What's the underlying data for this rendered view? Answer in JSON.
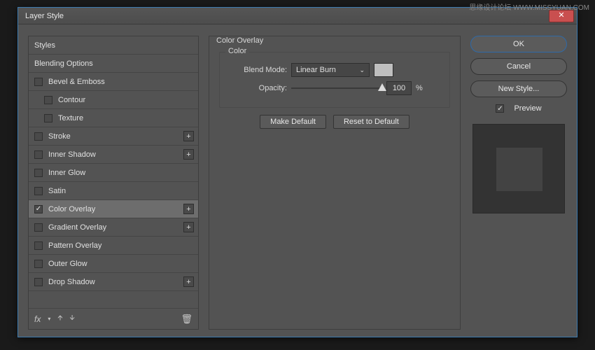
{
  "watermark": "思缘设计论坛   WWW.MISSYUAN.COM",
  "window": {
    "title": "Layer Style"
  },
  "sidebar": {
    "header1": "Styles",
    "header2": "Blending Options",
    "items": [
      {
        "label": "Bevel & Emboss",
        "checked": false,
        "plus": false
      },
      {
        "label": "Contour",
        "checked": false,
        "plus": false,
        "indent": true
      },
      {
        "label": "Texture",
        "checked": false,
        "plus": false,
        "indent": true
      },
      {
        "label": "Stroke",
        "checked": false,
        "plus": true
      },
      {
        "label": "Inner Shadow",
        "checked": false,
        "plus": true
      },
      {
        "label": "Inner Glow",
        "checked": false,
        "plus": false
      },
      {
        "label": "Satin",
        "checked": false,
        "plus": false
      },
      {
        "label": "Color Overlay",
        "checked": true,
        "selected": true,
        "plus": true
      },
      {
        "label": "Gradient Overlay",
        "checked": false,
        "plus": true
      },
      {
        "label": "Pattern Overlay",
        "checked": false,
        "plus": false
      },
      {
        "label": "Outer Glow",
        "checked": false,
        "plus": false
      },
      {
        "label": "Drop Shadow",
        "checked": false,
        "plus": true
      }
    ],
    "fx_label": "fx"
  },
  "panel": {
    "title": "Color Overlay",
    "group_label": "Color",
    "blend_mode_label": "Blend Mode:",
    "blend_mode_value": "Linear Burn",
    "swatch_color": "#bfbfbf",
    "opacity_label": "Opacity:",
    "opacity_value": "100",
    "opacity_pct": "%",
    "make_default": "Make Default",
    "reset_default": "Reset to Default"
  },
  "actions": {
    "ok": "OK",
    "cancel": "Cancel",
    "new_style": "New Style...",
    "preview": "Preview",
    "preview_checked": true
  }
}
